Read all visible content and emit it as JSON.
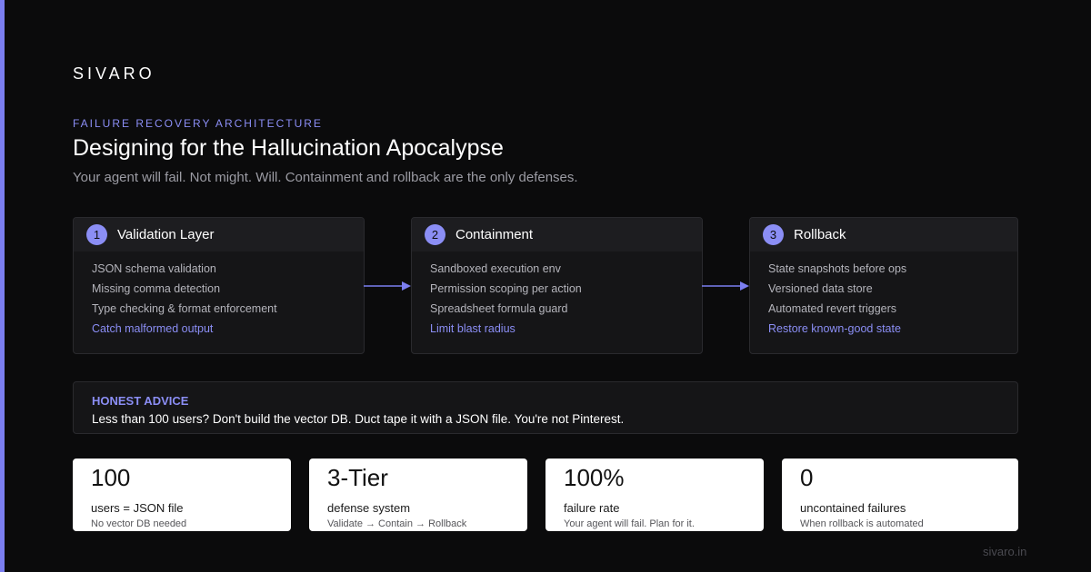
{
  "brand": "SIVARO",
  "eyebrow": "FAILURE RECOVERY ARCHITECTURE",
  "headline": "Designing for the Hallucination Apocalypse",
  "subhead": "Your agent will fail. Not might. Will. Containment and rollback are the only defenses.",
  "steps": [
    {
      "number": "1",
      "title": "Validation Layer",
      "items": [
        "JSON schema validation",
        "Missing comma detection",
        "Type checking & format enforcement"
      ],
      "highlight": "Catch malformed output"
    },
    {
      "number": "2",
      "title": "Containment",
      "items": [
        "Sandboxed execution env",
        "Permission scoping per action",
        "Spreadsheet formula guard"
      ],
      "highlight": "Limit blast radius"
    },
    {
      "number": "3",
      "title": "Rollback",
      "items": [
        "State snapshots before ops",
        "Versioned data store",
        "Automated revert triggers"
      ],
      "highlight": "Restore known-good state"
    }
  ],
  "advice": {
    "label": "HONEST ADVICE",
    "text": "Less than 100 users? Don't build the vector DB. Duct tape it with a JSON file. You're not Pinterest."
  },
  "stats": [
    {
      "value": "100",
      "label": "users = JSON file",
      "note": "No vector DB needed"
    },
    {
      "value": "3-Tier",
      "label": "defense system",
      "note": "Validate → Contain → Rollback"
    },
    {
      "value": "100%",
      "label": "failure rate",
      "note": "Your agent will fail. Plan for it."
    },
    {
      "value": "0",
      "label": "uncontained failures",
      "note": "When rollback is automated"
    }
  ],
  "footer_url": "sivaro.in",
  "colors": {
    "accent": "#8b8ef5",
    "background": "#0b0b0c",
    "card": "#151517"
  },
  "icons": {
    "arrow": "arrow-right-icon"
  }
}
